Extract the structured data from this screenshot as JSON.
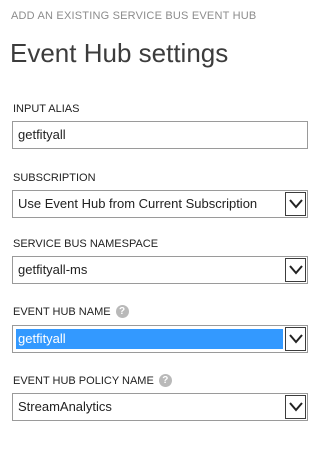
{
  "header": {
    "subtitle": "ADD AN EXISTING SERVICE BUS EVENT HUB",
    "title": "Event Hub settings"
  },
  "fields": {
    "input_alias": {
      "label": "INPUT ALIAS",
      "value": "getfityall"
    },
    "subscription": {
      "label": "SUBSCRIPTION",
      "value": "Use Event Hub from Current Subscription"
    },
    "namespace": {
      "label": "SERVICE BUS NAMESPACE",
      "value": "getfityall-ms"
    },
    "event_hub_name": {
      "label": "EVENT HUB NAME",
      "value": "getfityall",
      "help_icon": "question-icon"
    },
    "policy_name": {
      "label": "EVENT HUB POLICY NAME",
      "value": "StreamAnalytics",
      "help_icon": "question-icon"
    }
  },
  "colors": {
    "selection": "#3399ff",
    "border": "#9a9a9a"
  }
}
